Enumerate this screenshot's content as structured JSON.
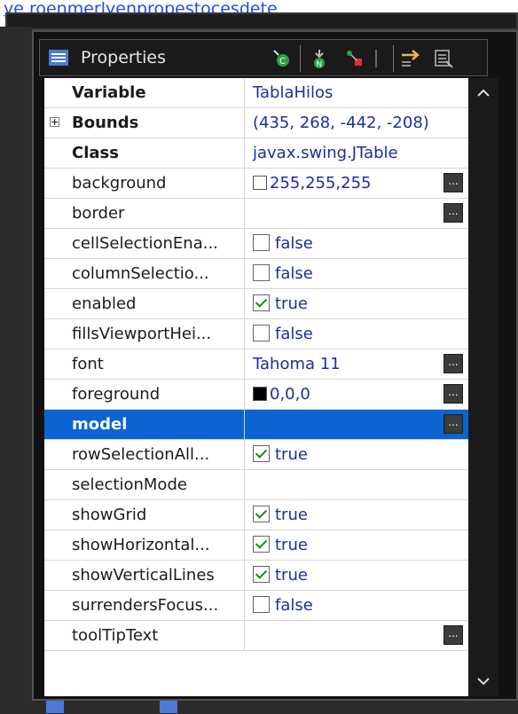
{
  "top_link": "y­e ro­en­me­r­l­y­en­pro­p­es­to­ces­de­te",
  "panel": {
    "title": "Properties"
  },
  "properties": [
    {
      "name": "Variable",
      "value": "TablaHilos",
      "bold": true
    },
    {
      "name": "Bounds",
      "value": "(435, 268, -442, -208)",
      "bold": true,
      "expandable": true,
      "expander": "+"
    },
    {
      "name": "Class",
      "value": "javax.swing.JTable",
      "bold": true
    },
    {
      "name": "background",
      "value": "255,255,255",
      "swatch": "#ffffff",
      "editor": true
    },
    {
      "name": "border",
      "value": "",
      "editor": true
    },
    {
      "name": "cellSelectionEna...",
      "value": "false",
      "checkbox": false
    },
    {
      "name": "columnSelectio...",
      "value": "false",
      "checkbox": false
    },
    {
      "name": "enabled",
      "value": "true",
      "checkbox": true
    },
    {
      "name": "fillsViewportHei...",
      "value": "false",
      "checkbox": false
    },
    {
      "name": "font",
      "value": "Tahoma 11",
      "editor": true
    },
    {
      "name": "foreground",
      "value": "0,0,0",
      "swatch": "#000000",
      "editor": true
    },
    {
      "name": "model",
      "value": "",
      "editor": true,
      "selected": true
    },
    {
      "name": "rowSelectionAll...",
      "value": "true",
      "checkbox": true
    },
    {
      "name": "selectionMode",
      "value": ""
    },
    {
      "name": "showGrid",
      "value": "true",
      "checkbox": true
    },
    {
      "name": "showHorizontal...",
      "value": "true",
      "checkbox": true
    },
    {
      "name": "showVerticalLines",
      "value": "true",
      "checkbox": true
    },
    {
      "name": "surrendersFocus...",
      "value": "false",
      "checkbox": false
    },
    {
      "name": "toolTipText",
      "value": "",
      "editor": true
    }
  ],
  "editor_label": "...",
  "colors": {
    "selection": "#0a64d2",
    "value_text": "#1c2e9e",
    "panel_bg": "#1a1a1a"
  },
  "icons": {
    "toolbar": [
      "show-events-icon",
      "goto-definition-icon",
      "add-component-icon",
      "remove-component-icon",
      "sort-icon",
      "expand-all-icon"
    ],
    "scroll": [
      "chevron-up-icon",
      "chevron-down-icon"
    ]
  }
}
